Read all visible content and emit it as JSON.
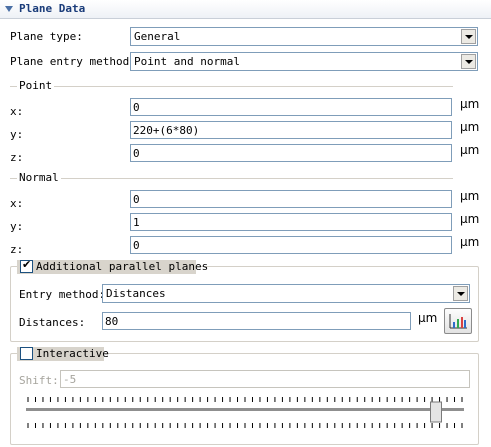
{
  "panel": {
    "title": "Plane Data"
  },
  "plane_type": {
    "label": "Plane type:",
    "value": "General"
  },
  "entry_method": {
    "label": "Plane entry method:",
    "value": "Point and normal"
  },
  "point": {
    "title": "Point",
    "x": {
      "label": "x:",
      "value": "0",
      "unit": "µm"
    },
    "y": {
      "label": "y:",
      "value": "220+(6*80)",
      "unit": "µm"
    },
    "z": {
      "label": "z:",
      "value": "0",
      "unit": "µm"
    }
  },
  "normal": {
    "title": "Normal",
    "x": {
      "label": "x:",
      "value": "0",
      "unit": "µm"
    },
    "y": {
      "label": "y:",
      "value": "1",
      "unit": "µm"
    },
    "z": {
      "label": "z:",
      "value": "0",
      "unit": "µm"
    }
  },
  "parallel_planes": {
    "checkbox_label": "Additional parallel planes",
    "checked": true,
    "entry_method_label": "Entry method:",
    "entry_method_value": "Distances",
    "distances_label": "Distances:",
    "distances_value": "80",
    "distances_unit": "µm",
    "graph_button_icon": "range-graph-icon"
  },
  "interactive": {
    "checkbox_label": "Interactive",
    "checked": false,
    "shift_label": "Shift:",
    "shift_value": "-5",
    "slider_position_fraction": 0.94
  }
}
